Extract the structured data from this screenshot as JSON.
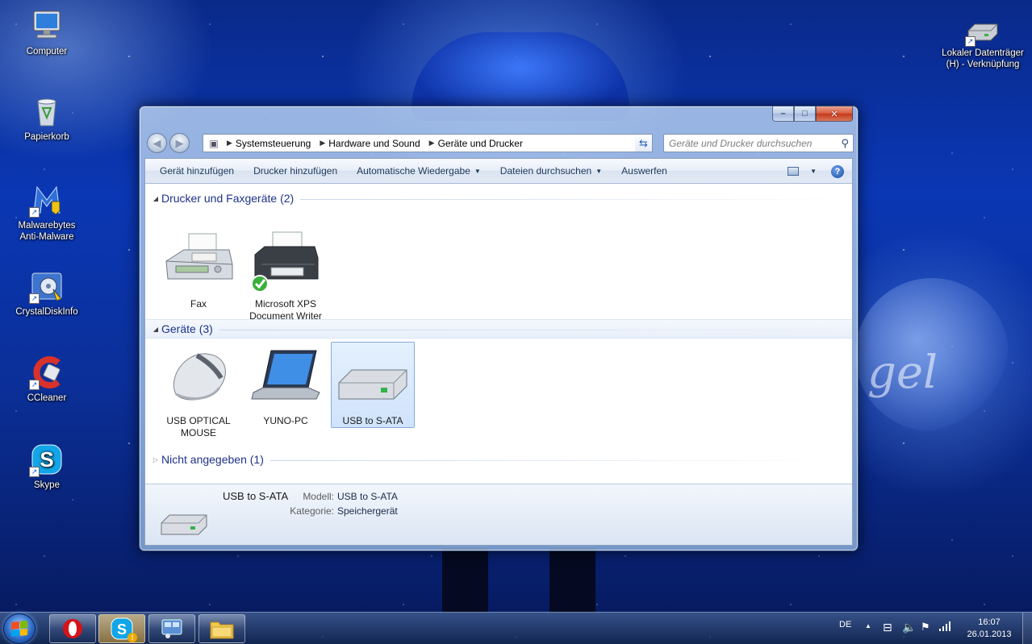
{
  "desktop": {
    "icons": [
      {
        "label_line1": "Computer",
        "label_line2": ""
      },
      {
        "label_line1": "Papierkorb",
        "label_line2": ""
      },
      {
        "label_line1": "Malwarebytes",
        "label_line2": "Anti-Malware"
      },
      {
        "label_line1": "CrystalDiskInfo",
        "label_line2": ""
      },
      {
        "label_line1": "CCleaner",
        "label_line2": ""
      },
      {
        "label_line1": "Skype",
        "label_line2": ""
      },
      {
        "label_line1": "Lokaler Datenträger",
        "label_line2": "(H) - Verknüpfung"
      }
    ]
  },
  "window": {
    "buttons": {
      "minimize": "–",
      "maximize": "□",
      "close": "✕"
    },
    "breadcrumb": [
      "Systemsteuerung",
      "Hardware und Sound",
      "Geräte und Drucker"
    ],
    "search_placeholder": "Geräte und Drucker durchsuchen",
    "commands": {
      "add_device": "Gerät hinzufügen",
      "add_printer": "Drucker hinzufügen",
      "autoplay": "Automatische Wiedergabe",
      "browse_files": "Dateien durchsuchen",
      "eject": "Auswerfen",
      "help": "?"
    },
    "groups": {
      "printers": {
        "title": "Drucker und Faxgeräte (2)",
        "items": [
          {
            "line1": "Fax",
            "line2": ""
          },
          {
            "line1": "Microsoft XPS",
            "line2": "Document Writer"
          }
        ]
      },
      "devices": {
        "title": "Geräte (3)",
        "items": [
          {
            "line1": "USB OPTICAL",
            "line2": "MOUSE"
          },
          {
            "line1": "YUNO-PC",
            "line2": ""
          },
          {
            "line1": "USB to S-ATA",
            "line2": ""
          }
        ]
      },
      "unspecified": {
        "title": "Nicht angegeben (1)"
      }
    },
    "details": {
      "name": "USB to S-ATA",
      "model_label": "Modell:",
      "model_value": "USB to S-ATA",
      "category_label": "Kategorie:",
      "category_value": "Speichergerät"
    }
  },
  "taskbar": {
    "language": "DE",
    "time": "16:07",
    "date": "26.01.2013",
    "skype_badge": "!"
  }
}
